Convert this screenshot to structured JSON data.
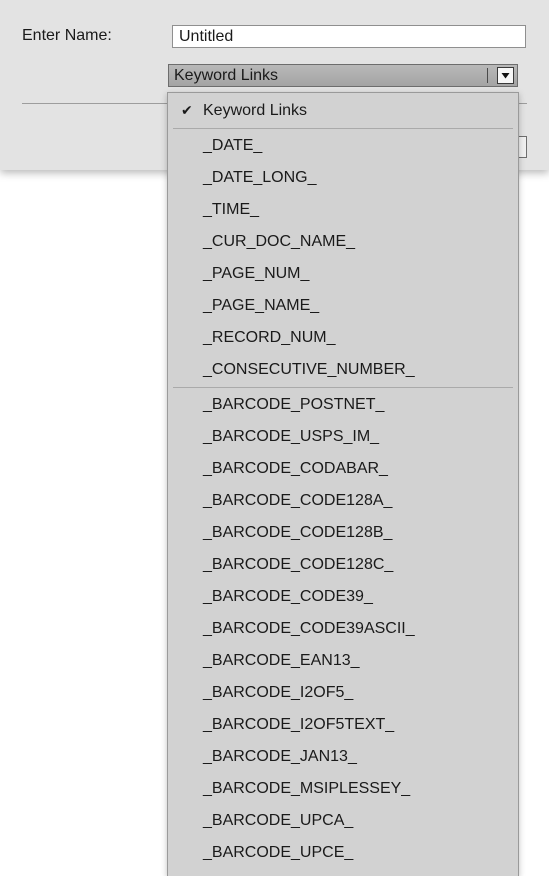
{
  "form": {
    "name_label": "Enter Name:",
    "name_value": "Untitled"
  },
  "dropdown": {
    "selected": "Keyword Links",
    "icon": "chevron-down-icon",
    "checked_icon": "checkmark-icon",
    "groups": [
      [
        "Keyword Links"
      ],
      [
        "_DATE_",
        "_DATE_LONG_",
        "_TIME_",
        "_CUR_DOC_NAME_",
        "_PAGE_NUM_",
        "_PAGE_NAME_",
        "_RECORD_NUM_",
        "_CONSECUTIVE_NUMBER_"
      ],
      [
        "_BARCODE_POSTNET_",
        "_BARCODE_USPS_IM_",
        "_BARCODE_CODABAR_",
        "_BARCODE_CODE128A_",
        "_BARCODE_CODE128B_",
        "_BARCODE_CODE128C_",
        "_BARCODE_CODE39_",
        "_BARCODE_CODE39ASCII_",
        "_BARCODE_EAN13_",
        "_BARCODE_I2OF5_",
        "_BARCODE_I2OF5TEXT_",
        "_BARCODE_JAN13_",
        "_BARCODE_MSIPLESSEY_",
        "_BARCODE_UPCA_",
        "_BARCODE_UPCE_"
      ]
    ]
  }
}
